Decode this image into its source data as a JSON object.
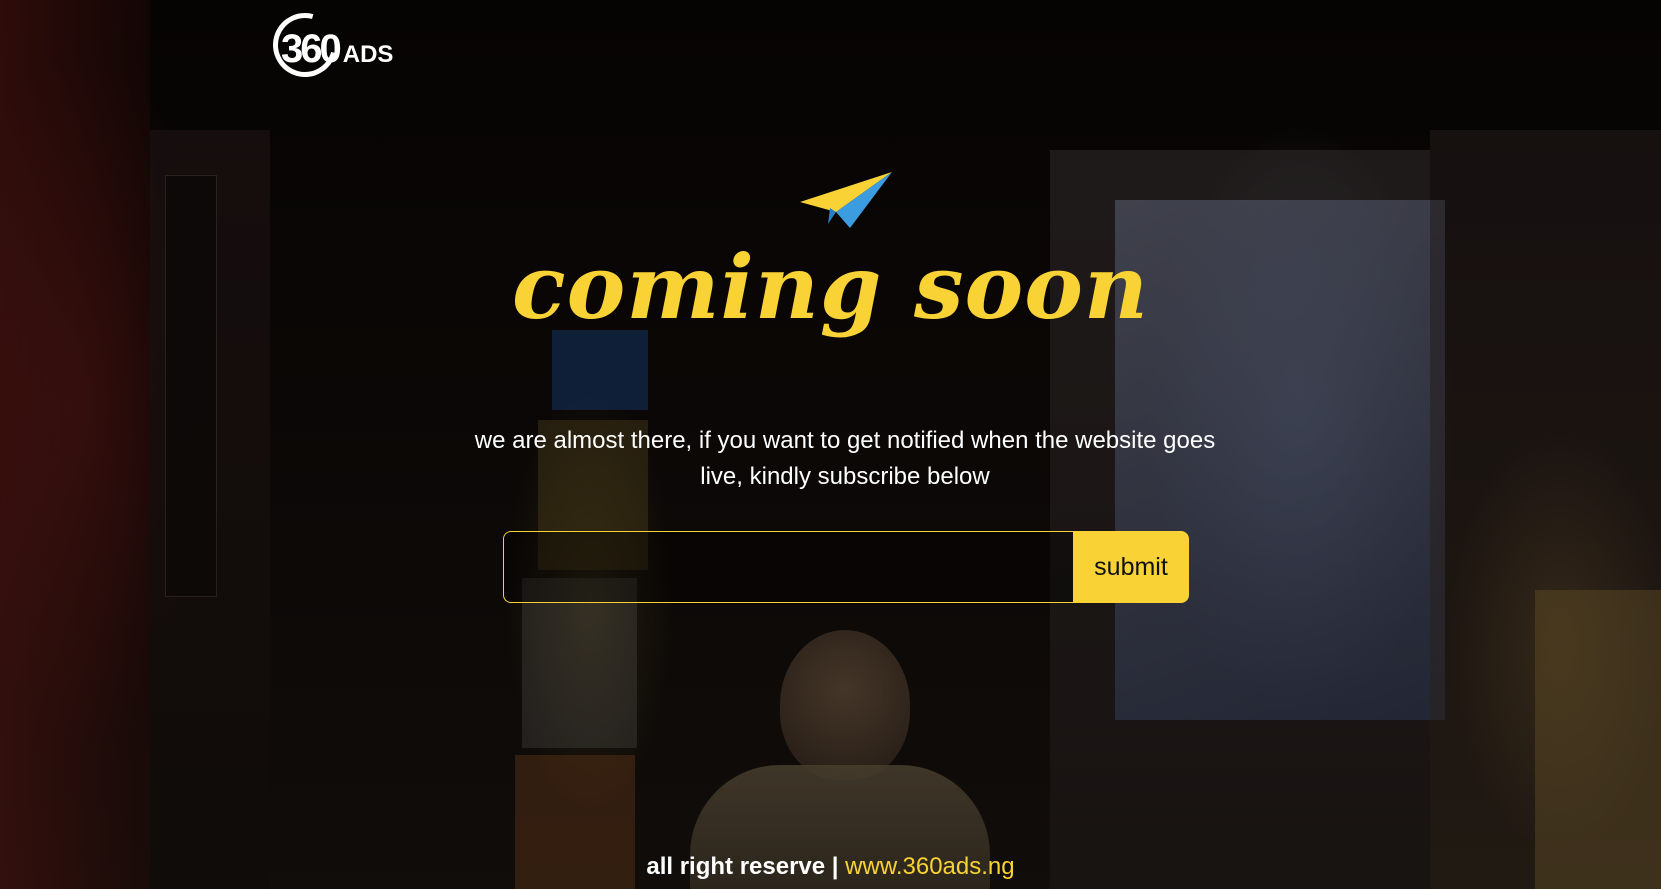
{
  "logo": {
    "number": "360",
    "word": "ADS"
  },
  "icons": {
    "plane": "paper-plane-icon"
  },
  "colors": {
    "accent": "#f9d235",
    "text": "#ffffff",
    "plane_yellow": "#f9d235",
    "plane_blue": "#3b9de0"
  },
  "hero": {
    "title": "coming soon",
    "subtitle": "we are almost there, if you want to get notified when the website goes live, kindly subscribe below"
  },
  "form": {
    "email_value": "",
    "email_placeholder": "",
    "submit_label": "submit"
  },
  "footer": {
    "text": "all right reserve | ",
    "link": "www.360ads.ng"
  }
}
